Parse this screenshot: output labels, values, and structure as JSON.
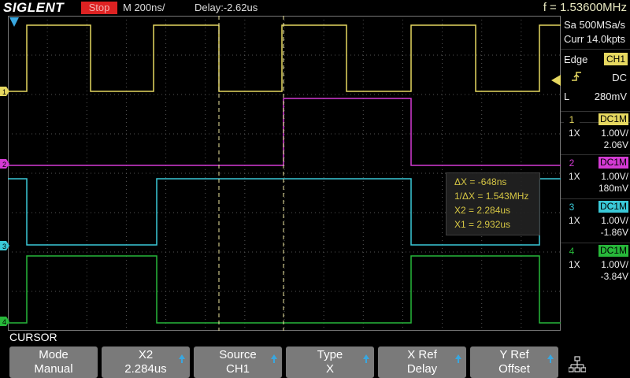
{
  "header": {
    "logo": "SIGLENT",
    "run_state": "Stop",
    "timebase": "M 200ns/",
    "delay": "Delay:-2.62us",
    "frequency": "f = 1.53600MHz"
  },
  "acquisition": {
    "sample_rate": "Sa 500MSa/s",
    "memory": "Curr 14.0kpts"
  },
  "trigger": {
    "type": "Edge",
    "source": "CH1",
    "slope_icon": "rising-edge-icon",
    "coupling": "DC",
    "level_label": "L",
    "level": "280mV"
  },
  "channels": [
    {
      "num": "1",
      "coupling": "DC1M",
      "probe": "1X",
      "scale": "1.00V/",
      "offset": "2.06V",
      "color": "#e6d860"
    },
    {
      "num": "2",
      "coupling": "DC1M",
      "probe": "1X",
      "scale": "1.00V/",
      "offset": "180mV",
      "color": "#d43bd4"
    },
    {
      "num": "3",
      "coupling": "DC1M",
      "probe": "1X",
      "scale": "1.00V/",
      "offset": "-1.86V",
      "color": "#3ac9d8"
    },
    {
      "num": "4",
      "coupling": "DC1M",
      "probe": "1X",
      "scale": "1.00V/",
      "offset": "-3.84V",
      "color": "#27b83a"
    }
  ],
  "cursor_readout": {
    "dx": "ΔX = -648ns",
    "inv_dx": "1/ΔX = 1.543MHz",
    "x2": "X2 = 2.284us",
    "x1": "X1 = 2.932us"
  },
  "menu": {
    "title": "CURSOR",
    "buttons": [
      {
        "label": "Mode",
        "value": "Manual",
        "has_arrow": false
      },
      {
        "label": "X2",
        "value": "2.284us",
        "has_arrow": true
      },
      {
        "label": "Source",
        "value": "CH1",
        "has_arrow": true
      },
      {
        "label": "Type",
        "value": "X",
        "has_arrow": true
      },
      {
        "label": "X Ref",
        "value": "Delay",
        "has_arrow": true
      },
      {
        "label": "Y Ref",
        "value": "Offset",
        "has_arrow": true
      }
    ]
  },
  "icons": {
    "trigger_position": "trigger-position-icon",
    "trigger_level": "trigger-level-icon",
    "network": "network-icon"
  }
}
